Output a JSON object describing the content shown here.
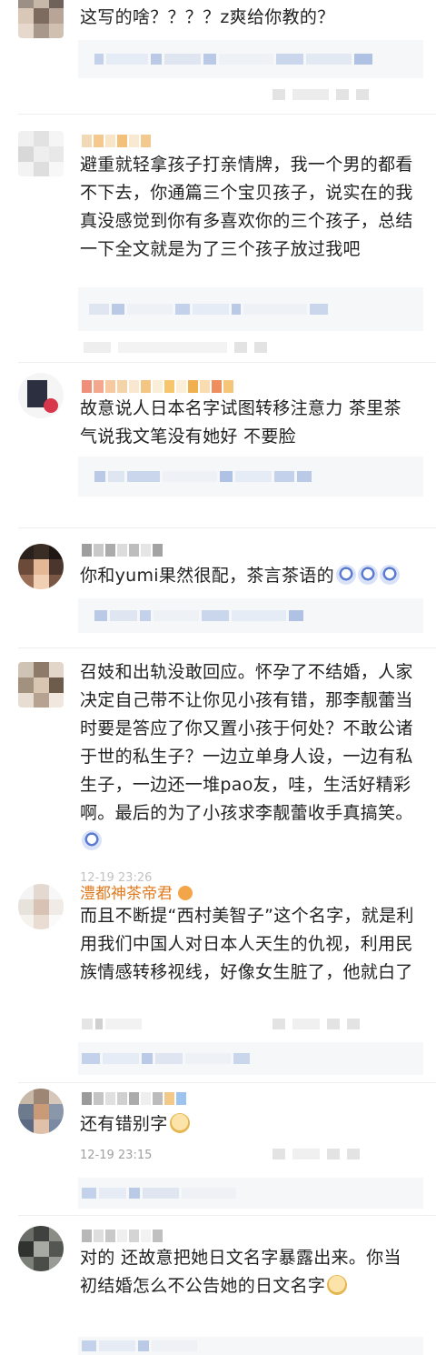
{
  "comments": [
    {
      "text": "这写的啥？？？？z爽给你教的？"
    },
    {
      "text": "避重就轻拿孩子打亲情牌，我一个男的都看不下去，你通篇三个宝贝孩子，说实在的我真没感觉到你有多喜欢你的三个孩子，总结一下全文就是为了三个孩子放过我吧"
    },
    {
      "text": "故意说人日本名字试图转移注意力 茶里茶气说我文笔没有她好 不要脸"
    },
    {
      "text": "你和yumi果然很配，茶言茶语的"
    },
    {
      "text": "召妓和出轨没敢回应。怀孕了不结婚，人家决定自己带不让你见小孩有错，那李靓蕾当时要是答应了你又置小孩于何处？不敢公诸于世的私生子？一边立单身人设，一边有私生子，一边还一堆pao友，哇，生活好精彩啊。最后的为了小孩求李靓蕾收手真搞笑。",
      "time": "12-19 23:26"
    },
    {
      "name": "澧都神茶帝君",
      "text": "而且不断提“西村美智子”这个名字，就是利用我们中国人对日本人天生的仇视，利用民族情感转移视线，好像女生脏了，他就白了"
    },
    {
      "text": "还有错别字",
      "time": "12-19 23:15"
    },
    {
      "text": "对的 还故意把她日文名字暴露出来。你当初结婚怎么不公告她的日文名字"
    }
  ],
  "icons": {
    "emoji_face": "surprised-face-emoji",
    "emoji_doge": "doge-emoji",
    "badge": "crown-badge-icon"
  },
  "colors": {
    "username": "#e07a1e",
    "text": "#222222",
    "time": "#a0a0a0",
    "reply_bg": "#f6f7f9",
    "blur_blue": "#b9c9e6"
  }
}
